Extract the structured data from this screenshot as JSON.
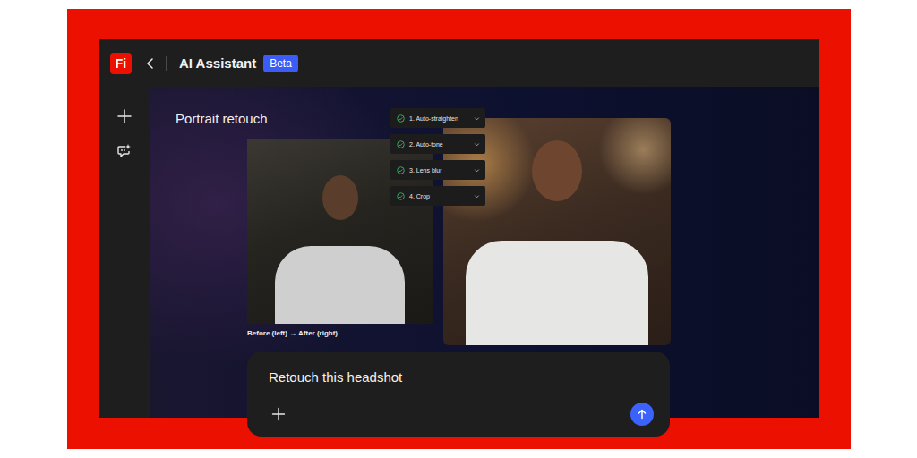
{
  "app": {
    "logo": "Fi",
    "title": "AI Assistant",
    "badge": "Beta"
  },
  "project": {
    "title": "Portrait retouch"
  },
  "steps": [
    {
      "label": "1. Auto-straighten",
      "done": true,
      "expanded": false
    },
    {
      "label": "2. Auto-tone",
      "done": true,
      "expanded": false
    },
    {
      "label": "3. Lens blur",
      "done": true,
      "expanded": false
    },
    {
      "label": "4. Crop",
      "done": true,
      "expanded": false
    }
  ],
  "comparison": {
    "caption": "Before (left) → After (right)"
  },
  "prompt": {
    "text": "Retouch this headshot"
  }
}
